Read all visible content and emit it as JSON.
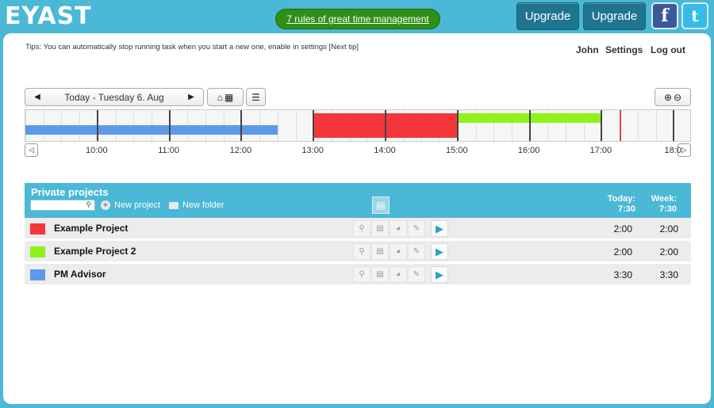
{
  "header": {
    "logo_text": "EYAST",
    "promo_link": "7 rules of great time management",
    "upgrade_button_1": "Upgrade",
    "upgrade_button_2": "Upgrade",
    "facebook_label": "f",
    "twitter_label": "t"
  },
  "tips": "Tips: You can automatically stop running task when you start a new one, enable in settings [Next tip]",
  "user_nav": {
    "user": "John",
    "settings": "Settings",
    "logout": "Log out"
  },
  "date_nav": {
    "label": "Today - Tuesday 6. Aug"
  },
  "timeline": {
    "hours": [
      "10:00",
      "11:00",
      "12:00",
      "13:00",
      "14:00",
      "15:00",
      "16:00",
      "17:00",
      "18:0"
    ],
    "entries": [
      {
        "project": "PM Advisor",
        "color": "#5b9be8",
        "start": "09:00",
        "end": "12:30"
      },
      {
        "project": "Example Project",
        "color": "#f5363b",
        "start": "13:00",
        "end": "15:00"
      },
      {
        "project": "Example Project 2",
        "color": "#8ef21b",
        "start": "15:00",
        "end": "17:00"
      }
    ],
    "now_marker": "17:15"
  },
  "projects": {
    "title": "Private projects",
    "new_project": "New project",
    "new_folder": "New folder",
    "today_label": "Today:",
    "today_total": "7:30",
    "week_label": "Week:",
    "week_total": "7:30",
    "rows": [
      {
        "name": "Example Project",
        "color": "#f5363b",
        "today": "2:00",
        "week": "2:00"
      },
      {
        "name": "Example Project 2",
        "color": "#8ef21b",
        "today": "2:00",
        "week": "2:00"
      },
      {
        "name": "PM Advisor",
        "color": "#5b9be8",
        "today": "3:30",
        "week": "3:30"
      }
    ]
  }
}
